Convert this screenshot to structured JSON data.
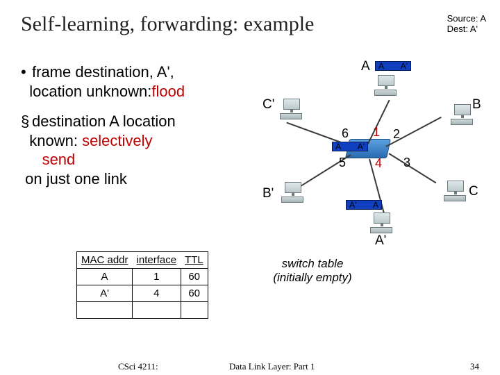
{
  "title": "Self-learning, forwarding: example",
  "srcdest": {
    "src": "Source: A",
    "dst": "Dest: A'"
  },
  "bullets": {
    "b1": {
      "sym": "•",
      "l1": "frame destination, A',",
      "l2a": "location unknown:",
      "l2b": "flood"
    },
    "b2": {
      "sym": "§",
      "l1": "destination A location",
      "l2a": "known: ",
      "l2b": "selectively",
      "l3": "send",
      "l4": "on just one link"
    }
  },
  "labels": {
    "A": "A",
    "B": "B",
    "C": "C",
    "Ap": "A'",
    "Bp": "B'",
    "Cp": "C'"
  },
  "ports": {
    "p1": "1",
    "p2": "2",
    "p3": "3",
    "p4": "4",
    "p5": "5",
    "p6": "6"
  },
  "pkt": {
    "a1": "A",
    "a2": "A'",
    "a1r": "A'",
    "a2r": "A"
  },
  "table": {
    "h1": "MAC addr",
    "h2": "interface",
    "h3": "TTL",
    "r1": {
      "c1": "A",
      "c2": "1",
      "c3": "60"
    },
    "r2": {
      "c1": "A'",
      "c2": "4",
      "c3": "60"
    }
  },
  "caption": {
    "l1": "switch table",
    "l2": "(initially empty)"
  },
  "footer": {
    "left": "CSci 4211:",
    "center": "Data Link Layer: Part 1",
    "right": "34"
  }
}
